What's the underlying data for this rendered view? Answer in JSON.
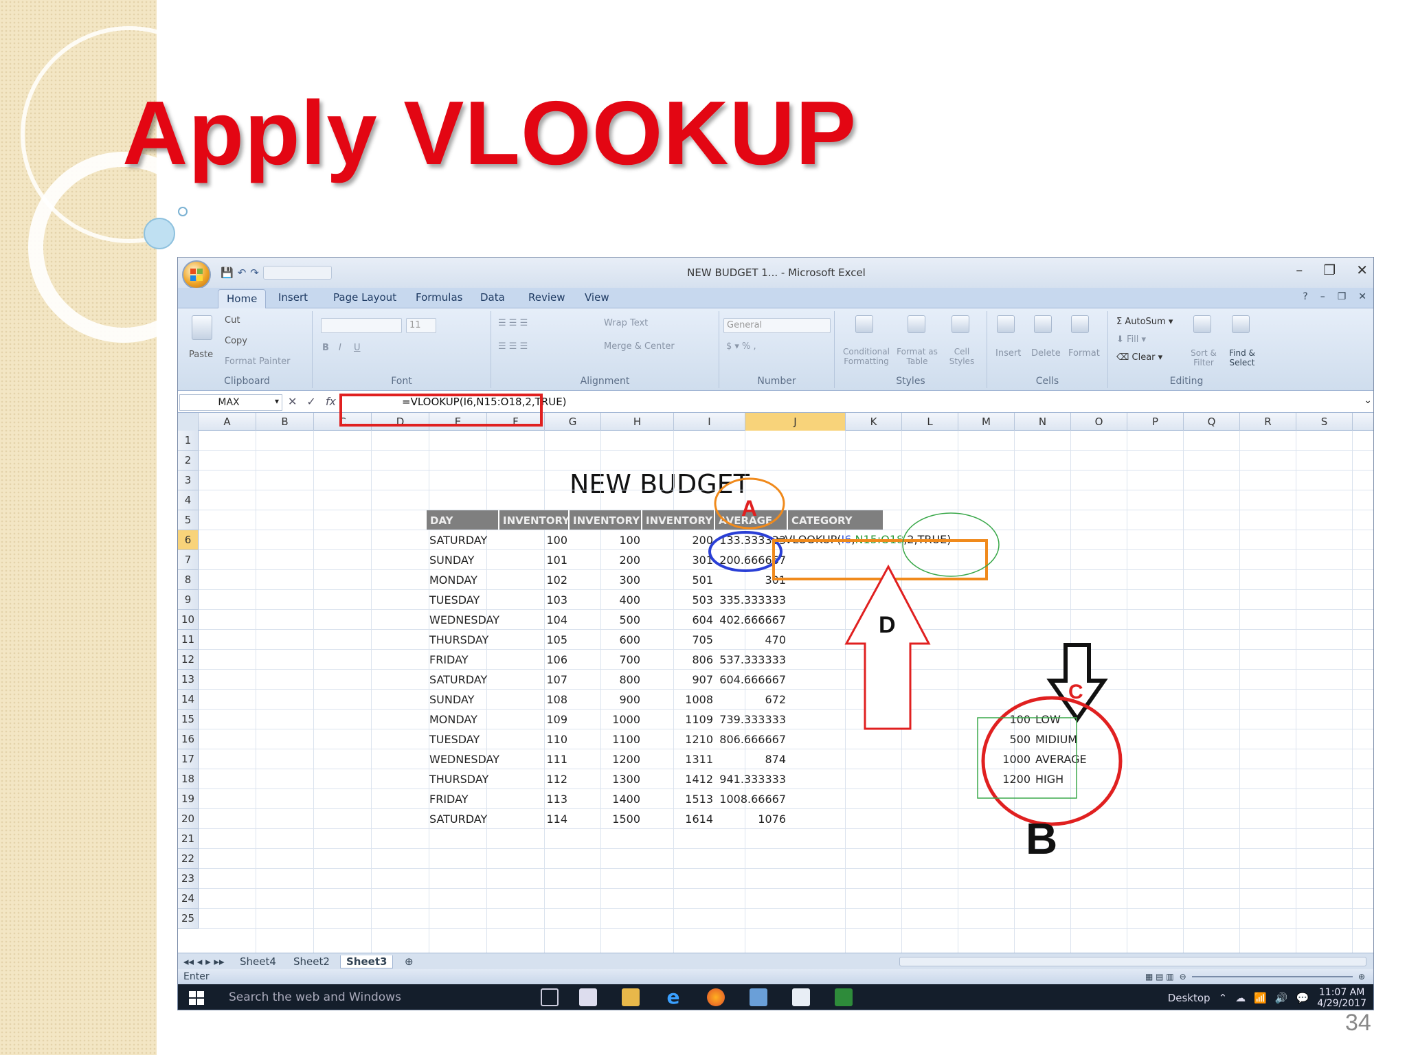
{
  "slide": {
    "title": "Apply VLOOKUP",
    "page_number": "34"
  },
  "excel": {
    "window_title": "NEW BUDGET 1... - Microsoft Excel",
    "window_controls": {
      "minimize": "–",
      "restore": "❐",
      "close": "✕"
    },
    "ribbon_tabs": [
      "Home",
      "Insert",
      "Page Layout",
      "Formulas",
      "Data",
      "Review",
      "View"
    ],
    "clipboard": {
      "paste": "Paste",
      "cut": "Cut",
      "copy": "Copy",
      "format_painter": "Format Painter",
      "label": "Clipboard"
    },
    "font": {
      "size": "11",
      "label": "Font"
    },
    "alignment": {
      "wrap_text": "Wrap Text",
      "merge_center": "Merge & Center",
      "label": "Alignment"
    },
    "number": {
      "format": "General",
      "label": "Number"
    },
    "styles": {
      "conditional": "Conditional Formatting",
      "format_table": "Format as Table",
      "cell_styles": "Cell Styles",
      "label": "Styles"
    },
    "cells": {
      "insert": "Insert",
      "delete": "Delete",
      "format": "Format",
      "label": "Cells"
    },
    "editing": {
      "autosum": "AutoSum",
      "fill": "Fill",
      "clear": "Clear",
      "sort_filter": "Sort & Filter",
      "find_select": "Find & Select",
      "label": "Editing"
    },
    "formula_bar": {
      "name_box": "MAX",
      "cancel": "✕",
      "enter": "✓",
      "fx": "fx",
      "formula": "=VLOOKUP(I6,N15:O18,2,TRUE)"
    },
    "columns": [
      "A",
      "B",
      "C",
      "D",
      "E",
      "F",
      "G",
      "H",
      "I",
      "J",
      "K",
      "L",
      "M",
      "N",
      "O",
      "P",
      "Q",
      "R",
      "S"
    ],
    "rows": [
      "1",
      "2",
      "3",
      "4",
      "5",
      "6",
      "7",
      "8",
      "9",
      "10",
      "11",
      "12",
      "13",
      "14",
      "15",
      "16",
      "17",
      "18",
      "19",
      "20",
      "21",
      "22",
      "23",
      "24",
      "25"
    ],
    "table_title": "NEW BUDGET",
    "table_headers": [
      "DAY",
      "INVENTORY",
      "INVENTORY",
      "INVENTORY",
      "AVERAGE",
      "CATEGORY"
    ],
    "table_rows": [
      [
        "SATURDAY",
        "100",
        "100",
        "200",
        "133.333333"
      ],
      [
        "SUNDAY",
        "101",
        "200",
        "301",
        "200.666667"
      ],
      [
        "MONDAY",
        "102",
        "300",
        "501",
        "301"
      ],
      [
        "TUESDAY",
        "103",
        "400",
        "503",
        "335.333333"
      ],
      [
        "WEDNESDAY",
        "104",
        "500",
        "604",
        "402.666667"
      ],
      [
        "THURSDAY",
        "105",
        "600",
        "705",
        "470"
      ],
      [
        "FRIDAY",
        "106",
        "700",
        "806",
        "537.333333"
      ],
      [
        "SATURDAY",
        "107",
        "800",
        "907",
        "604.666667"
      ],
      [
        "SUNDAY",
        "108",
        "900",
        "1008",
        "672"
      ],
      [
        "MONDAY",
        "109",
        "1000",
        "1109",
        "739.333333"
      ],
      [
        "TUESDAY",
        "110",
        "1100",
        "1210",
        "806.666667"
      ],
      [
        "WEDNESDAY",
        "111",
        "1200",
        "1311",
        "874"
      ],
      [
        "THURSDAY",
        "112",
        "1300",
        "1412",
        "941.333333"
      ],
      [
        "FRIDAY",
        "113",
        "1400",
        "1513",
        "1008.66667"
      ],
      [
        "SATURDAY",
        "114",
        "1500",
        "1614",
        "1076"
      ]
    ],
    "edit_formula": {
      "prefix": "=VLOOKUP(",
      "ref1": "I6",
      "sep": ",",
      "ref2": "N15:O18",
      "suffix": ",2,TRUE)"
    },
    "lookup_table": [
      [
        "100",
        "LOW"
      ],
      [
        "500",
        "MIDIUM"
      ],
      [
        "1000",
        "AVERAGE"
      ],
      [
        "1200",
        "HIGH"
      ]
    ],
    "annotations": {
      "a": "A",
      "b": "B",
      "c": "C",
      "d": "D"
    },
    "sheet_tabs": [
      "Sheet4",
      "Sheet2",
      "Sheet3"
    ],
    "status_mode": "Enter"
  },
  "taskbar": {
    "search_placeholder": "Search the web and Windows",
    "desktop_label": "Desktop",
    "time": "11:07 AM",
    "date": "4/29/2017"
  },
  "colors": {
    "title_red": "#e30613",
    "annotation_red": "#e02020",
    "orange": "#f08a1c",
    "blue": "#2a3fd6",
    "green": "#3aa84a"
  }
}
